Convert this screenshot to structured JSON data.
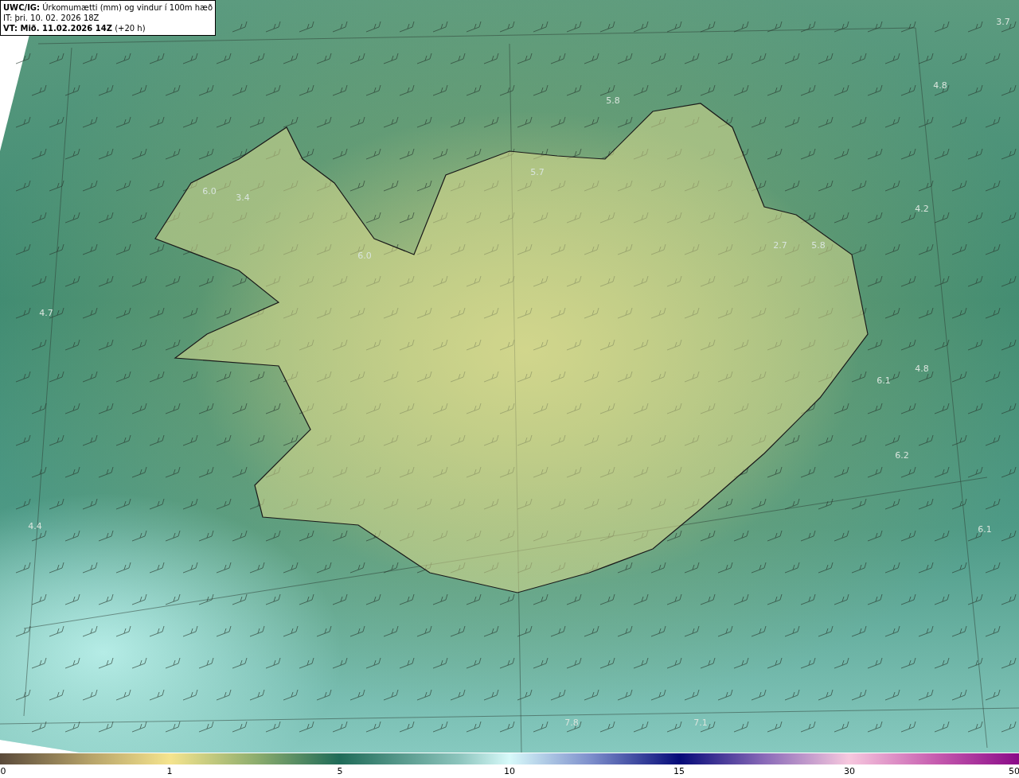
{
  "header": {
    "model": "UWC/IG:",
    "title": "Úrkomumætti (mm) og vindur í 100m hæð",
    "init": "IT: þri. 10. 02. 2026 18Z",
    "valid": "VT: Mið. 11.02.2026 14Z",
    "lead": "(+20 h)"
  },
  "map": {
    "value_labels": [
      "3.7",
      "5.8",
      "4.8",
      "6.0",
      "3.4",
      "5.7",
      "4.2",
      "6.0",
      "2.7",
      "5.8",
      "4.7",
      "4.8",
      "6.1",
      "6.2",
      "4.4",
      "6.1",
      "7.8",
      "7.1"
    ]
  },
  "colorbar": {
    "ticks": [
      "0",
      "1",
      "5",
      "10",
      "15",
      "30",
      "50"
    ]
  }
}
